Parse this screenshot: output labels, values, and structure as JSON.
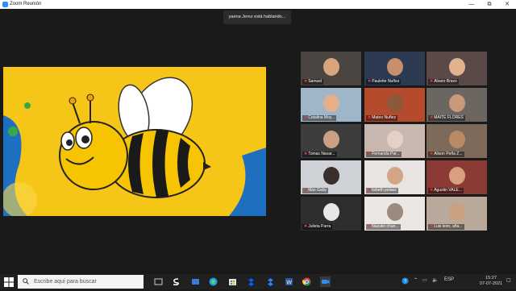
{
  "window": {
    "title": "Zoom Reunión",
    "minimize": "—",
    "maximize": "⧉",
    "close": "✕"
  },
  "speaking_banner": "yaena Jerez está hablando...",
  "participants": [
    {
      "name": "Samuel"
    },
    {
      "name": "Paulette Nuñez"
    },
    {
      "name": "Alvaro Bravo"
    },
    {
      "name": "Catalina Moy..."
    },
    {
      "name": "Mateo Nuñez"
    },
    {
      "name": "MAITE FLORES"
    },
    {
      "name": "Tomas Navar..."
    },
    {
      "name": "Fernanda Par..."
    },
    {
      "name": "Alison Peña Z..."
    },
    {
      "name": "Max Gaby"
    },
    {
      "name": "lisbeth pelaez"
    },
    {
      "name": "Agustin VALE..."
    },
    {
      "name": "Julieta Parra"
    },
    {
      "name": "Nazuko chan..."
    },
    {
      "name": "Luis leon, aña..."
    }
  ],
  "taskbar": {
    "search_placeholder": "Escribe aquí para buscar",
    "language": "ESP",
    "time": "15:27",
    "date": "07-07-2021"
  },
  "colors": {
    "share_bg": "#F5C518",
    "accent_blue": "#2D8CFF",
    "muted_mic": "#e53935"
  }
}
